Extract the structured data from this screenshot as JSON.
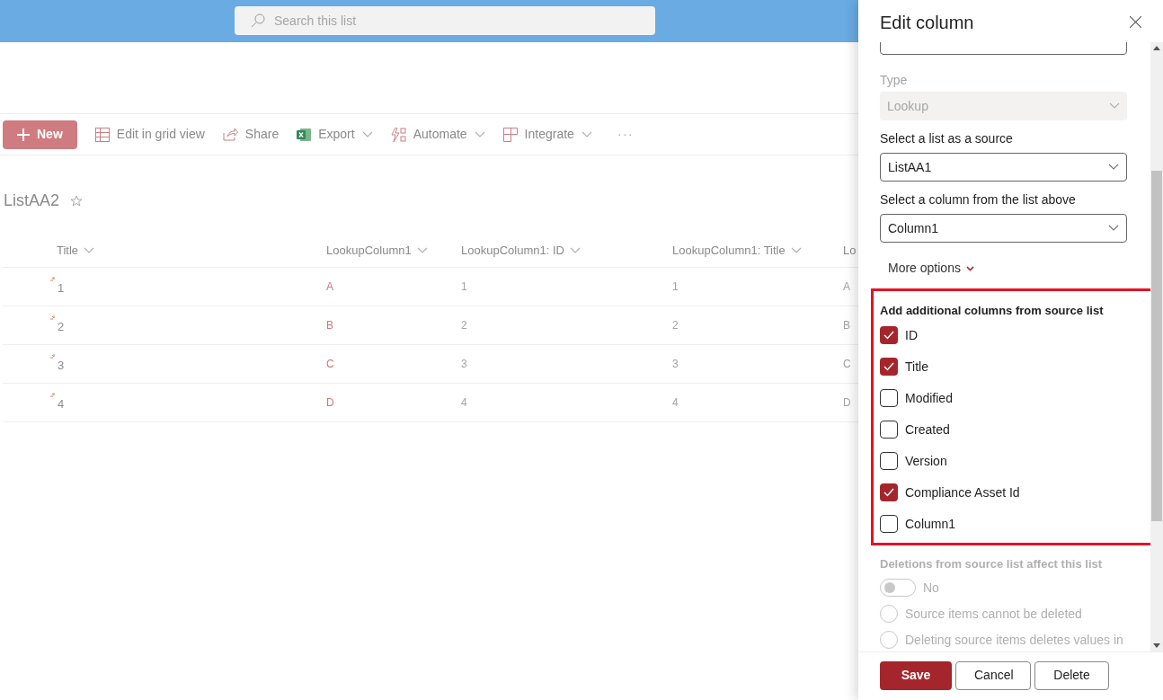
{
  "search": {
    "placeholder": "Search this list"
  },
  "toolbar": [
    {
      "kind": "new",
      "label": "New"
    },
    {
      "kind": "grid",
      "label": "Edit in grid view"
    },
    {
      "kind": "share",
      "label": "Share"
    },
    {
      "kind": "export",
      "label": "Export",
      "dropdown": true
    },
    {
      "kind": "automate",
      "label": "Automate",
      "dropdown": true
    },
    {
      "kind": "integrate",
      "label": "Integrate",
      "dropdown": true
    },
    {
      "kind": "more",
      "label": "···"
    }
  ],
  "list_title": "ListAA2",
  "table": {
    "columns": [
      "Title",
      "LookupColumn1",
      "LookupColumn1: ID",
      "LookupColumn1: Title",
      "Lo"
    ],
    "rows": [
      [
        "1",
        "A",
        "1",
        "1",
        "A"
      ],
      [
        "2",
        "B",
        "2",
        "2",
        "B"
      ],
      [
        "3",
        "C",
        "3",
        "3",
        "C"
      ],
      [
        "4",
        "D",
        "4",
        "4",
        "D"
      ]
    ]
  },
  "panel": {
    "title": "Edit column",
    "type_label": "Type",
    "type_value": "Lookup",
    "source_label": "Select a list as a source",
    "source_value": "ListAA1",
    "column_label": "Select a column from the list above",
    "column_value": "Column1",
    "more_options": "More options",
    "additional_label": "Add additional columns from source list",
    "additional_columns": [
      {
        "label": "ID",
        "checked": true
      },
      {
        "label": "Title",
        "checked": true
      },
      {
        "label": "Modified",
        "checked": false
      },
      {
        "label": "Created",
        "checked": false
      },
      {
        "label": "Version",
        "checked": false
      },
      {
        "label": "Compliance Asset Id",
        "checked": true
      },
      {
        "label": "Column1",
        "checked": false
      }
    ],
    "deletions_label": "Deletions from source list affect this list",
    "deletions_toggle": {
      "on": false,
      "label": "No"
    },
    "deletion_options": [
      {
        "label": "Source items cannot be deleted",
        "selected": false
      },
      {
        "label": "Deleting source items deletes values in",
        "selected": false
      }
    ],
    "buttons": [
      "Save",
      "Cancel",
      "Delete"
    ]
  }
}
